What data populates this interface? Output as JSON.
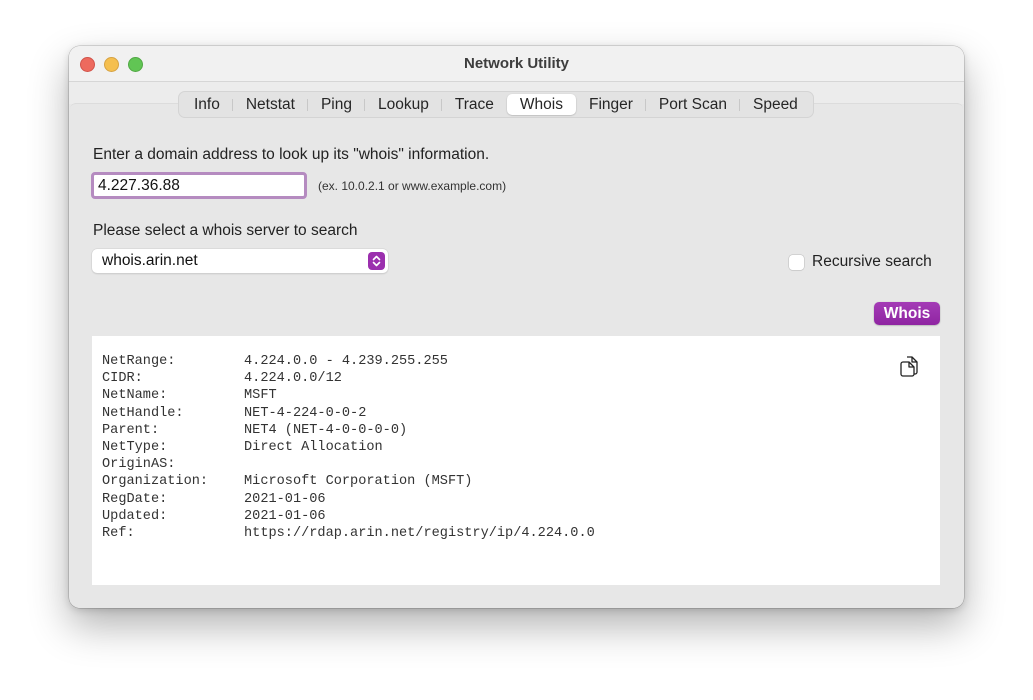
{
  "window": {
    "title": "Network Utility"
  },
  "tabs": [
    {
      "label": "Info",
      "active": false
    },
    {
      "label": "Netstat",
      "active": false
    },
    {
      "label": "Ping",
      "active": false
    },
    {
      "label": "Lookup",
      "active": false
    },
    {
      "label": "Trace",
      "active": false
    },
    {
      "label": "Whois",
      "active": true
    },
    {
      "label": "Finger",
      "active": false
    },
    {
      "label": "Port Scan",
      "active": false
    },
    {
      "label": "Speed",
      "active": false
    }
  ],
  "whois": {
    "domain_label": "Enter a domain address to look up its \"whois\" information.",
    "domain_value": "4.227.36.88",
    "domain_hint": "(ex. 10.0.2.1 or www.example.com)",
    "server_label": "Please select a whois server to search",
    "server_selected": "whois.arin.net",
    "recursive_label": "Recursive search",
    "recursive_checked": false,
    "button_label": "Whois",
    "accent_color": "#9b2fae"
  },
  "output": {
    "rows": [
      {
        "key": "NetRange:",
        "value": "4.224.0.0 - 4.239.255.255"
      },
      {
        "key": "CIDR:",
        "value": "4.224.0.0/12"
      },
      {
        "key": "NetName:",
        "value": "MSFT"
      },
      {
        "key": "NetHandle:",
        "value": "NET-4-224-0-0-2"
      },
      {
        "key": "Parent:",
        "value": "NET4 (NET-4-0-0-0-0)"
      },
      {
        "key": "NetType:",
        "value": "Direct Allocation"
      },
      {
        "key": "OriginAS:",
        "value": ""
      },
      {
        "key": "Organization:",
        "value": "Microsoft Corporation (MSFT)"
      },
      {
        "key": "RegDate:",
        "value": "2021-01-06"
      },
      {
        "key": "Updated:",
        "value": "2021-01-06"
      },
      {
        "key": "Ref:",
        "value": "https://rdap.arin.net/registry/ip/4.224.0.0"
      }
    ],
    "copy_icon": "copy-documents-icon"
  }
}
